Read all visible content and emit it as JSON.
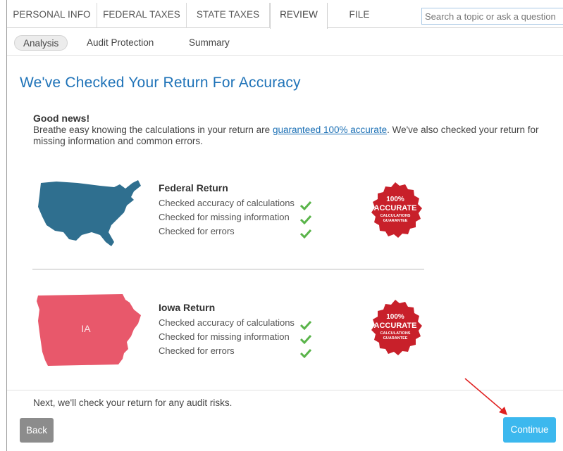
{
  "topnav": {
    "tabs": [
      {
        "label": "PERSONAL INFO"
      },
      {
        "label": "FEDERAL TAXES"
      },
      {
        "label": "STATE TAXES"
      },
      {
        "label": "REVIEW"
      },
      {
        "label": "FILE"
      }
    ],
    "active_tab": "REVIEW",
    "search_placeholder": "Search a topic or ask a question"
  },
  "subnav": {
    "tabs": [
      {
        "label": "Analysis"
      },
      {
        "label": "Audit Protection"
      },
      {
        "label": "Summary"
      }
    ],
    "active_tab": "Analysis"
  },
  "page": {
    "title": "We've Checked Your Return For Accuracy",
    "good_news_heading": "Good news!",
    "intro_before_link": "Breathe easy knowing the calculations in your return are ",
    "intro_link": "guaranteed 100% accurate",
    "intro_after_link": ". We've also checked your return for missing information and common errors."
  },
  "returns": [
    {
      "title": "Federal Return",
      "checks": [
        "Checked accuracy of calculations",
        "Checked for missing information",
        "Checked for errors"
      ],
      "map_icon": "usa-map-icon"
    },
    {
      "title": "Iowa Return",
      "state_abbr": "IA",
      "checks": [
        "Checked accuracy of calculations",
        "Checked for missing information",
        "Checked for errors"
      ],
      "map_icon": "iowa-map-icon"
    }
  ],
  "seal": {
    "line1": "100%",
    "line2": "ACCURATE",
    "line3": "CALCULATIONS",
    "line4": "GUARANTEE"
  },
  "footer": {
    "next_text": "Next, we'll check your return for any audit risks.",
    "back_label": "Back",
    "continue_label": "Continue"
  },
  "colors": {
    "title_blue": "#1f73b8",
    "usa_map": "#2f6f8f",
    "iowa_map": "#e8586b",
    "seal_red": "#c8202a",
    "check_green": "#5ab44a",
    "continue_button": "#3cb8ee",
    "back_button": "#8c8c8c",
    "annotation_arrow": "#e02020"
  }
}
